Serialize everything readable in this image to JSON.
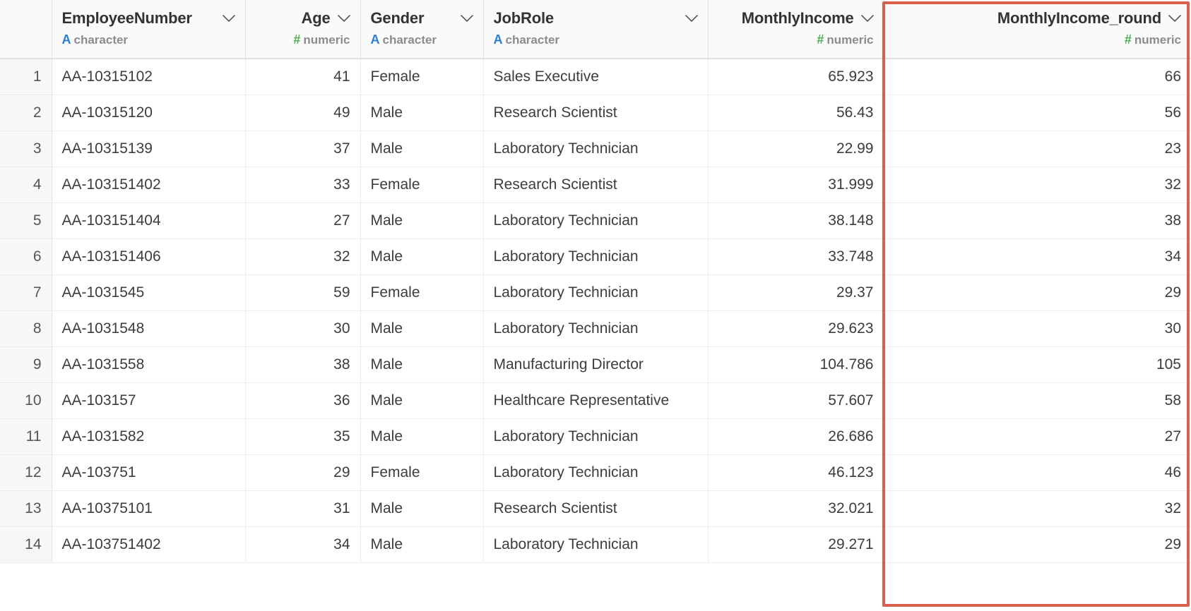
{
  "table": {
    "row_number_header": "",
    "columns": [
      {
        "name": "EmployeeNumber",
        "type_label": "character",
        "type_badge": "A",
        "type_kind": "character",
        "align": "left",
        "highlighted": false
      },
      {
        "name": "Age",
        "type_label": "numeric",
        "type_badge": "#",
        "type_kind": "numeric",
        "align": "right",
        "highlighted": false
      },
      {
        "name": "Gender",
        "type_label": "character",
        "type_badge": "A",
        "type_kind": "character",
        "align": "left",
        "highlighted": false
      },
      {
        "name": "JobRole",
        "type_label": "character",
        "type_badge": "A",
        "type_kind": "character",
        "align": "left",
        "highlighted": false
      },
      {
        "name": "MonthlyIncome",
        "type_label": "numeric",
        "type_badge": "#",
        "type_kind": "numeric",
        "align": "right",
        "highlighted": false
      },
      {
        "name": "MonthlyIncome_round",
        "type_label": "numeric",
        "type_badge": "#",
        "type_kind": "numeric",
        "align": "right",
        "highlighted": true
      }
    ],
    "rows": [
      {
        "n": "1",
        "EmployeeNumber": "AA-10315102",
        "Age": "41",
        "Gender": "Female",
        "JobRole": "Sales Executive",
        "MonthlyIncome": "65.923",
        "MonthlyIncome_round": "66"
      },
      {
        "n": "2",
        "EmployeeNumber": "AA-10315120",
        "Age": "49",
        "Gender": "Male",
        "JobRole": "Research Scientist",
        "MonthlyIncome": "56.43",
        "MonthlyIncome_round": "56"
      },
      {
        "n": "3",
        "EmployeeNumber": "AA-10315139",
        "Age": "37",
        "Gender": "Male",
        "JobRole": "Laboratory Technician",
        "MonthlyIncome": "22.99",
        "MonthlyIncome_round": "23"
      },
      {
        "n": "4",
        "EmployeeNumber": "AA-103151402",
        "Age": "33",
        "Gender": "Female",
        "JobRole": "Research Scientist",
        "MonthlyIncome": "31.999",
        "MonthlyIncome_round": "32"
      },
      {
        "n": "5",
        "EmployeeNumber": "AA-103151404",
        "Age": "27",
        "Gender": "Male",
        "JobRole": "Laboratory Technician",
        "MonthlyIncome": "38.148",
        "MonthlyIncome_round": "38"
      },
      {
        "n": "6",
        "EmployeeNumber": "AA-103151406",
        "Age": "32",
        "Gender": "Male",
        "JobRole": "Laboratory Technician",
        "MonthlyIncome": "33.748",
        "MonthlyIncome_round": "34"
      },
      {
        "n": "7",
        "EmployeeNumber": "AA-1031545",
        "Age": "59",
        "Gender": "Female",
        "JobRole": "Laboratory Technician",
        "MonthlyIncome": "29.37",
        "MonthlyIncome_round": "29"
      },
      {
        "n": "8",
        "EmployeeNumber": "AA-1031548",
        "Age": "30",
        "Gender": "Male",
        "JobRole": "Laboratory Technician",
        "MonthlyIncome": "29.623",
        "MonthlyIncome_round": "30"
      },
      {
        "n": "9",
        "EmployeeNumber": "AA-1031558",
        "Age": "38",
        "Gender": "Male",
        "JobRole": "Manufacturing Director",
        "MonthlyIncome": "104.786",
        "MonthlyIncome_round": "105"
      },
      {
        "n": "10",
        "EmployeeNumber": "AA-103157",
        "Age": "36",
        "Gender": "Male",
        "JobRole": "Healthcare Representative",
        "MonthlyIncome": "57.607",
        "MonthlyIncome_round": "58"
      },
      {
        "n": "11",
        "EmployeeNumber": "AA-1031582",
        "Age": "35",
        "Gender": "Male",
        "JobRole": "Laboratory Technician",
        "MonthlyIncome": "26.686",
        "MonthlyIncome_round": "27"
      },
      {
        "n": "12",
        "EmployeeNumber": "AA-103751",
        "Age": "29",
        "Gender": "Female",
        "JobRole": "Laboratory Technician",
        "MonthlyIncome": "46.123",
        "MonthlyIncome_round": "46"
      },
      {
        "n": "13",
        "EmployeeNumber": "AA-10375101",
        "Age": "31",
        "Gender": "Male",
        "JobRole": "Research Scientist",
        "MonthlyIncome": "32.021",
        "MonthlyIncome_round": "32"
      },
      {
        "n": "14",
        "EmployeeNumber": "AA-103751402",
        "Age": "34",
        "Gender": "Male",
        "JobRole": "Laboratory Technician",
        "MonthlyIncome": "29.271",
        "MonthlyIncome_round": "29"
      }
    ]
  },
  "annotation": {
    "highlight_color": "#d9604f",
    "highlighted_column": "MonthlyIncome_round"
  },
  "theme": {
    "character_badge_color": "#2a7fd4",
    "numeric_badge_color": "#4caf50",
    "header_bg": "#fafafa",
    "gutter_bg": "#f7f7f7",
    "grid_line": "#ececec"
  }
}
